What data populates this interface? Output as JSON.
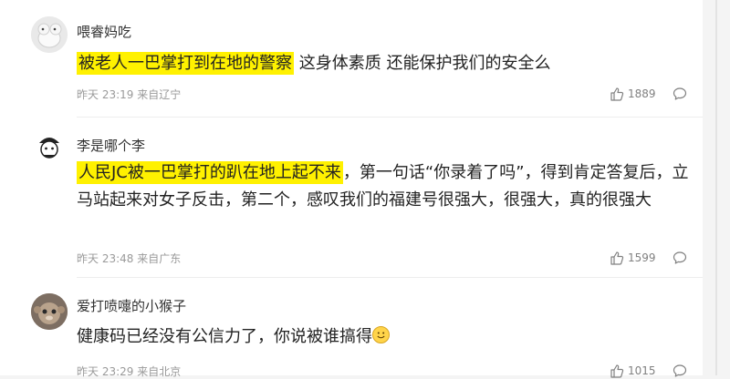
{
  "comments": [
    {
      "username": "喂睿妈吃",
      "highlight": "被老人一巴掌打到在地的警察",
      "text": " 这身体素质 还能保护我们的安全么",
      "time": "昨天 23:19",
      "location": "来自辽宁",
      "likes": "1889"
    },
    {
      "username": "李是哪个李",
      "highlight": "人民JC被一巴掌打的趴在地上起不来",
      "text": "，第一句话“你录着了吗”，得到肯定答复后，立马站起来对女子反击，第二个，感叹我们的福建号很强大，很强大，真的很强大",
      "time": "昨天 23:48",
      "location": "来自广东",
      "likes": "1599"
    },
    {
      "username": "爱打喷嚏的小猴子",
      "highlight": "",
      "text": "健康码已经没有公信力了，你说被谁搞得",
      "time": "昨天 23:29",
      "location": "来自北京",
      "likes": "1015"
    }
  ],
  "icons": {
    "like": "thumbs-up-icon",
    "comment": "comment-bubble-icon",
    "emoji": "smiley-emoji-icon"
  },
  "colors": {
    "highlight": "#fff100",
    "meta": "#9a9a9a",
    "divider": "#ededed"
  }
}
